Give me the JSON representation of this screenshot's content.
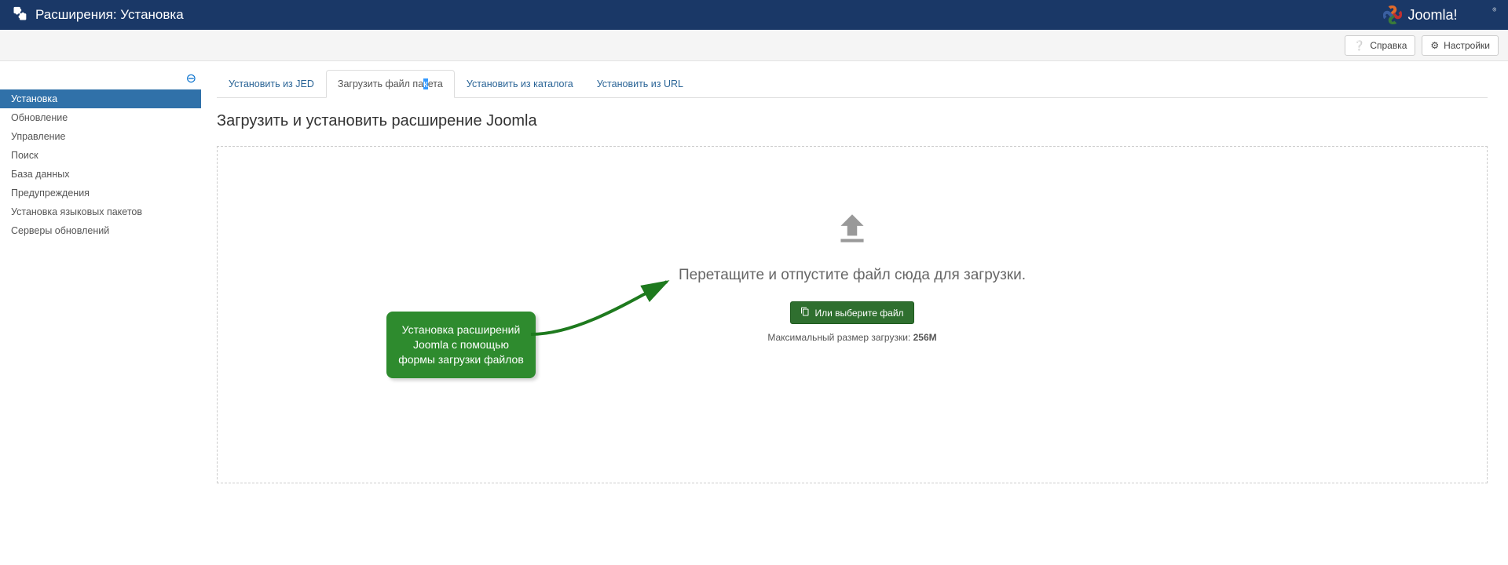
{
  "header": {
    "title": "Расширения: Установка",
    "brand": "Joomla!"
  },
  "toolbar": {
    "help_label": "Справка",
    "options_label": "Настройки"
  },
  "sidebar": {
    "items": [
      {
        "label": "Установка",
        "active": true
      },
      {
        "label": "Обновление",
        "active": false
      },
      {
        "label": "Управление",
        "active": false
      },
      {
        "label": "Поиск",
        "active": false
      },
      {
        "label": "База данных",
        "active": false
      },
      {
        "label": "Предупреждения",
        "active": false
      },
      {
        "label": "Установка языковых пакетов",
        "active": false
      },
      {
        "label": "Серверы обновлений",
        "active": false
      }
    ]
  },
  "tabs": [
    {
      "label": "Установить из JED",
      "active": false,
      "name": "install-jed"
    },
    {
      "label_pre": "Загрузить файл па",
      "label_mid": "к",
      "label_post": "ета",
      "active": true,
      "name": "upload-package"
    },
    {
      "label": "Установить из каталога",
      "active": false,
      "name": "install-folder"
    },
    {
      "label": "Установить из URL",
      "active": false,
      "name": "install-url"
    }
  ],
  "main": {
    "heading": "Загрузить и установить расширение Joomla",
    "drop_text": "Перетащите и отпустите файл сюда для загрузки.",
    "pick_button": "Или выберите файл",
    "max_label": "Максимальный размер загрузки: ",
    "max_value": "256M"
  },
  "callout": {
    "text": "Установка расширений Joomla с помощью формы загрузки файлов"
  }
}
